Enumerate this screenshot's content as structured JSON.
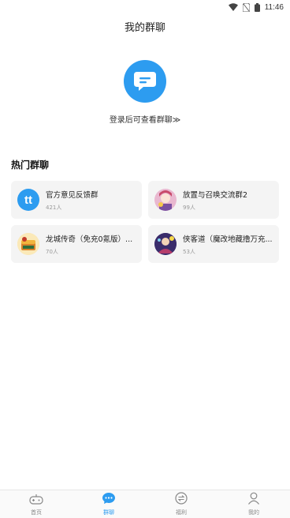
{
  "status_bar": {
    "time": "11:46",
    "icons": [
      "wifi-icon",
      "no-sim-icon",
      "battery-icon"
    ]
  },
  "header": {
    "title": "我的群聊"
  },
  "login": {
    "text": "登录后可查看群聊≫",
    "icon": "chat-bubbles-icon"
  },
  "hot_section": {
    "title": "热门群聊"
  },
  "groups": [
    {
      "name": "官方意见反馈群",
      "count": "421人",
      "avatar": "tt-logo"
    },
    {
      "name": "放置与召唤交流群2",
      "count": "99人",
      "avatar": "anime-girl"
    },
    {
      "name": "龙城传奇（免充0氪版）...",
      "count": "70人",
      "avatar": "game-chest"
    },
    {
      "name": "侠客道（魔改地藏撸万充...",
      "count": "53人",
      "avatar": "hero-character"
    }
  ],
  "tabbar": {
    "items": [
      {
        "label": "首页",
        "icon": "gamepad-icon",
        "active": false
      },
      {
        "label": "群聊",
        "icon": "chat-icon",
        "active": true
      },
      {
        "label": "福利",
        "icon": "exchange-icon",
        "active": false
      },
      {
        "label": "我的",
        "icon": "user-icon",
        "active": false
      }
    ]
  },
  "colors": {
    "accent": "#2d9cf0",
    "card_bg": "#f4f4f4",
    "muted": "#999999"
  }
}
